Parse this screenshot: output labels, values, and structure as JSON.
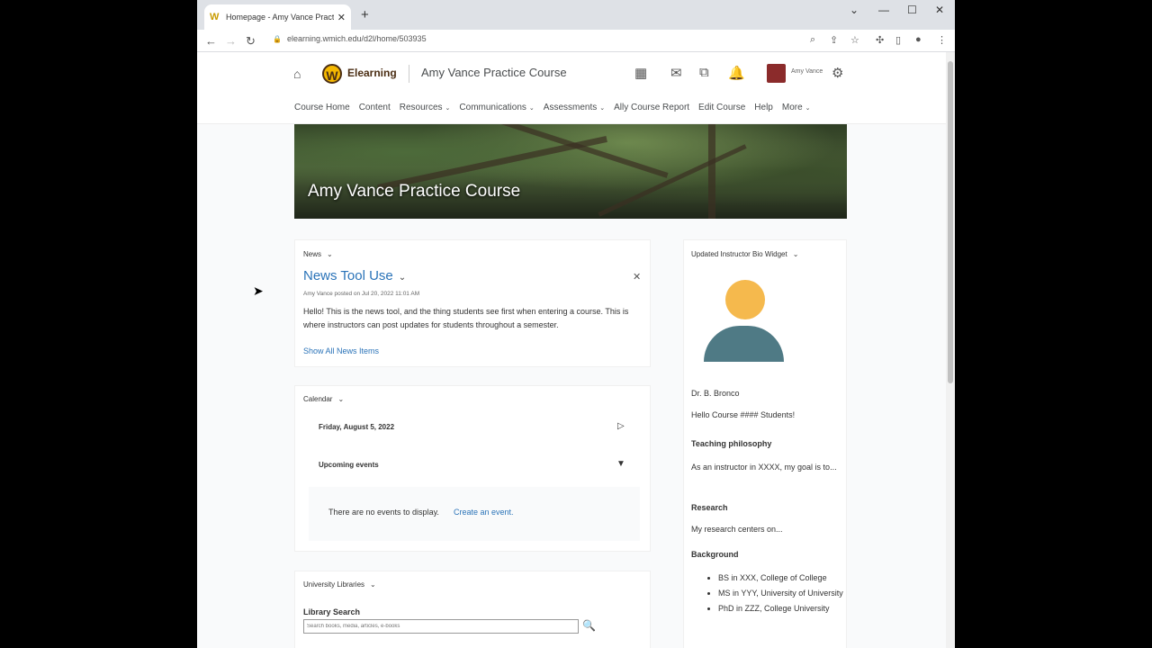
{
  "browser": {
    "tab_title": "Homepage - Amy Vance Practice",
    "tab_favicon": "W",
    "url": "elearning.wmich.edu/d2l/home/503935"
  },
  "header": {
    "logo_letter": "W",
    "logo_text": "Elearning",
    "course_title": "Amy Vance Practice Course",
    "user_name": "Amy Vance"
  },
  "nav": [
    {
      "label": "Course Home",
      "dropdown": false
    },
    {
      "label": "Content",
      "dropdown": false
    },
    {
      "label": "Resources",
      "dropdown": true
    },
    {
      "label": "Communications",
      "dropdown": true
    },
    {
      "label": "Assessments",
      "dropdown": true
    },
    {
      "label": "Ally Course Report",
      "dropdown": false
    },
    {
      "label": "Edit Course",
      "dropdown": false
    },
    {
      "label": "Help",
      "dropdown": false
    },
    {
      "label": "More",
      "dropdown": true
    }
  ],
  "banner": {
    "title": "Amy Vance Practice Course"
  },
  "news": {
    "header": "News",
    "item_title": "News Tool Use",
    "meta": "Amy Vance posted on Jul 20, 2022 11:01 AM",
    "body": "Hello! This is the news tool, and the thing students see first when entering a course. This is where instructors can post updates for students throughout a semester.",
    "show_all": "Show All News Items"
  },
  "calendar": {
    "header": "Calendar",
    "date": "Friday, August 5, 2022",
    "upcoming": "Upcoming events",
    "empty": "There are no events to display.",
    "create": "Create an event."
  },
  "libraries": {
    "header": "University Libraries",
    "search_label": "Library Search",
    "search_placeholder": "Search books, media, articles, e-books"
  },
  "bio": {
    "header": "Updated Instructor Bio Widget",
    "name": "Dr. B. Bronco",
    "greeting": "Hello Course #### Students!",
    "teaching_head": "Teaching philosophy",
    "teaching_text": "As an instructor in XXXX, my goal is to...",
    "research_head": "Research",
    "research_text": "My research centers on...",
    "background_head": "Background",
    "background_items": [
      "BS in XXX, College of College",
      "MS in YYY, University of University",
      "PhD in ZZZ, College University"
    ]
  }
}
